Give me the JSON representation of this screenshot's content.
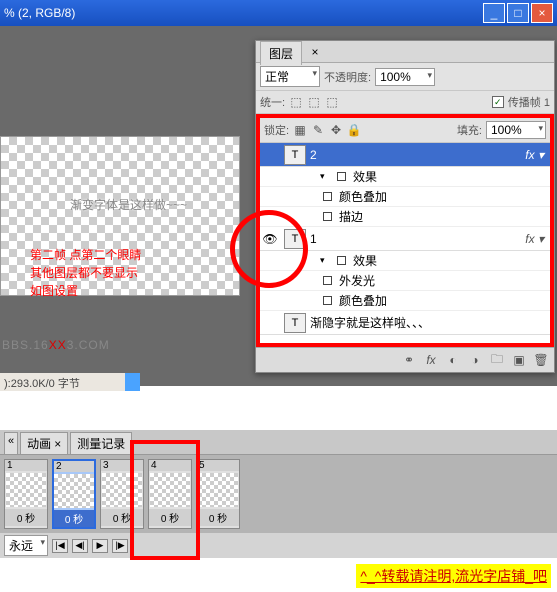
{
  "window": {
    "title": "% (2, RGB/8)"
  },
  "canvas": {
    "sample_text": "渐变字体是这样做~~~",
    "annotation_l1": "第二帧 点第二个眼睛",
    "annotation_l2": "其他图层都不要显示",
    "annotation_l3": "如图设置",
    "watermark_pre": "BBS.16",
    "watermark_red": "XX",
    "watermark_post": "3.COM",
    "status": "):293.0K/0 字节"
  },
  "layers_panel": {
    "tab_label": "图层",
    "blend_mode": "正常",
    "opacity_label": "不透明度:",
    "opacity_value": "100%",
    "unify_label": "统一:",
    "propagate_label": "传播帧 1",
    "lock_label": "锁定:",
    "fill_label": "填充:",
    "fill_value": "100%",
    "layers": [
      {
        "name": "2",
        "fx_label": "效果",
        "subs": [
          "颜色叠加",
          "描边"
        ]
      },
      {
        "name": "1",
        "fx_label": "效果",
        "subs": [
          "外发光",
          "颜色叠加"
        ]
      },
      {
        "name_long": "渐隐字就是这样啦、、、"
      }
    ]
  },
  "animation_panel": {
    "tab1": "动画",
    "tab2": "测量记录",
    "frames": [
      {
        "num": "1",
        "dur": "0 秒"
      },
      {
        "num": "2",
        "dur": "0 秒"
      },
      {
        "num": "3",
        "dur": "0 秒"
      },
      {
        "num": "4",
        "dur": "0 秒"
      },
      {
        "num": "5",
        "dur": "0 秒"
      }
    ],
    "loop": "永远"
  },
  "footer_note": "^_^转载请注明,流光字店铺_吧"
}
